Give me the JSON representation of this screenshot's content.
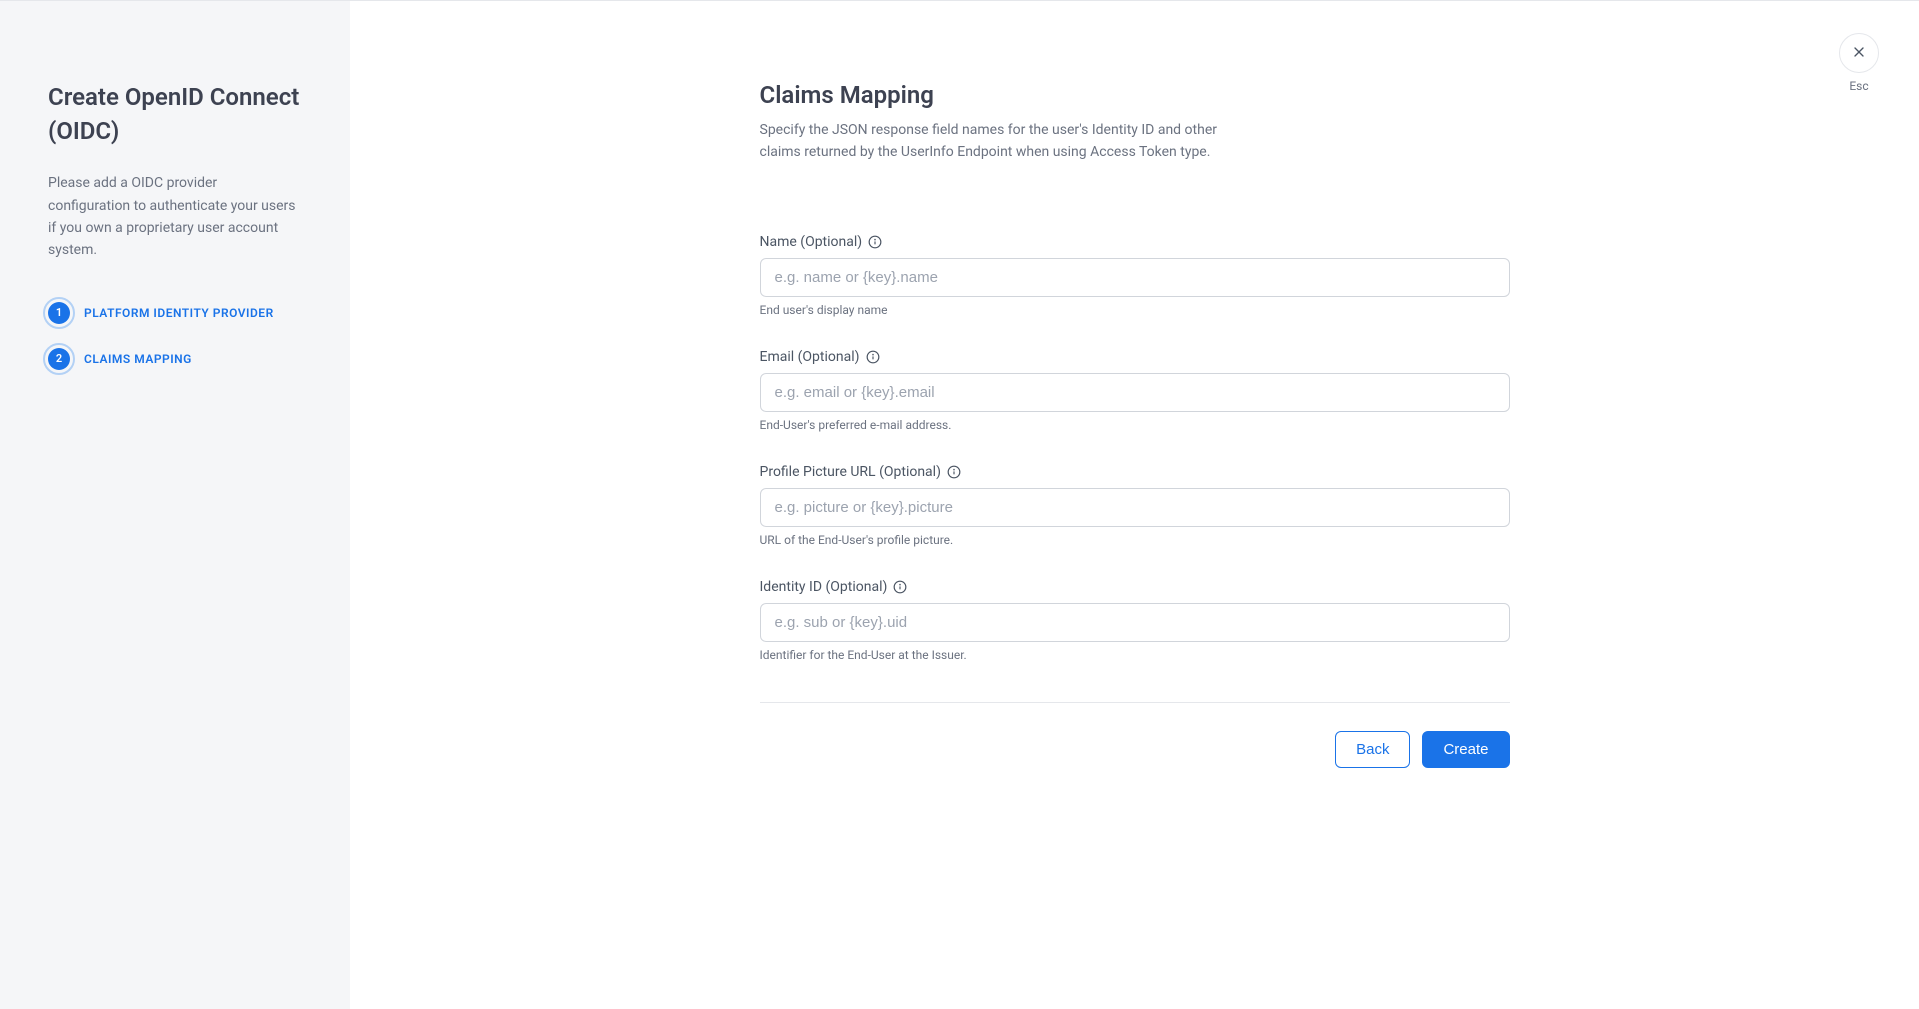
{
  "sidebar": {
    "title": "Create OpenID Connect (OIDC)",
    "description": "Please add a OIDC provider configuration to authenticate your users if you own a proprietary user account system.",
    "steps": [
      {
        "number": "1",
        "label": "PLATFORM IDENTITY PROVIDER"
      },
      {
        "number": "2",
        "label": "CLAIMS MAPPING"
      }
    ]
  },
  "close": {
    "label": "Esc"
  },
  "main": {
    "title": "Claims Mapping",
    "description": "Specify the JSON response field names for the user's Identity ID and other claims returned by the UserInfo Endpoint when using Access Token type.",
    "fields": [
      {
        "label": "Name (Optional)",
        "placeholder": "e.g. name or {key}.name",
        "hint": "End user's display name"
      },
      {
        "label": "Email (Optional)",
        "placeholder": "e.g. email or {key}.email",
        "hint": "End-User's preferred e-mail address."
      },
      {
        "label": "Profile Picture URL (Optional)",
        "placeholder": "e.g. picture or {key}.picture",
        "hint": "URL of the End-User's profile picture."
      },
      {
        "label": "Identity ID (Optional)",
        "placeholder": "e.g. sub or {key}.uid",
        "hint": "Identifier for the End-User at the Issuer."
      }
    ],
    "actions": {
      "back": "Back",
      "create": "Create"
    }
  }
}
